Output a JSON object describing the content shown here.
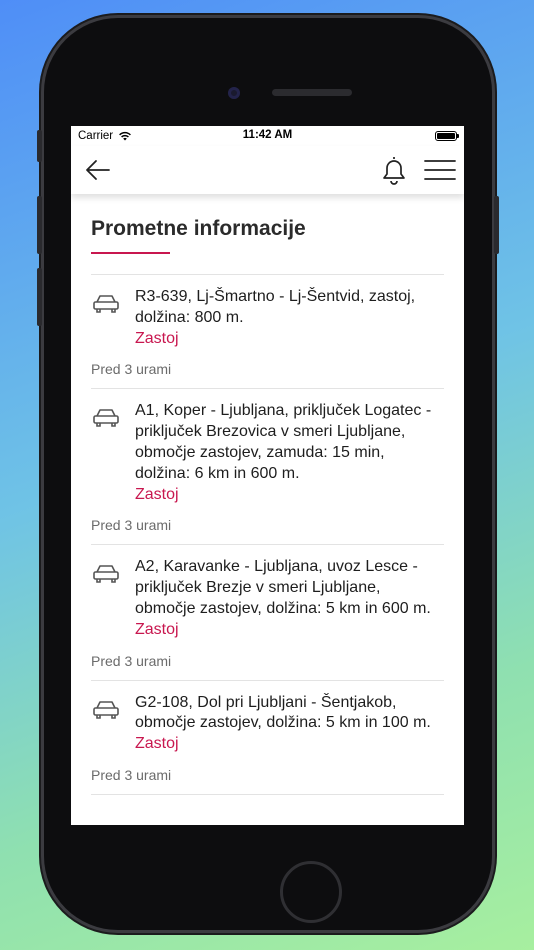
{
  "status_bar": {
    "carrier": "Carrier",
    "time": "11:42 AM"
  },
  "page": {
    "title": "Prometne informacije"
  },
  "items": [
    {
      "text": "R3-639, Lj-Šmartno - Lj-Šentvid, zastoj, dolžina: 800 m.",
      "type": "Zastoj",
      "time": "Pred 3 urami",
      "icon": "car-icon"
    },
    {
      "text": "A1, Koper - Ljubljana, priključek Logatec - priključek Brezovica v smeri Ljubljane, območje zastojev, zamuda: 15 min, dolžina: 6 km in 600 m.",
      "type": "Zastoj",
      "time": "Pred 3 urami",
      "icon": "car-icon"
    },
    {
      "text": "A2, Karavanke - Ljubljana, uvoz Lesce - priključek Brezje v smeri Ljubljane, območje zastojev, dolžina: 5 km in 600 m.",
      "type": "Zastoj",
      "time": "Pred 3 urami",
      "icon": "car-icon"
    },
    {
      "text": "G2-108, Dol pri Ljubljani - Šentjakob, območje zastojev, dolžina: 5 km in 100 m.",
      "type": "Zastoj",
      "time": "Pred 3 urami",
      "icon": "car-icon"
    }
  ],
  "colors": {
    "accent": "#c8174f",
    "text": "#1e1e1e",
    "muted": "#6b6b6b"
  }
}
